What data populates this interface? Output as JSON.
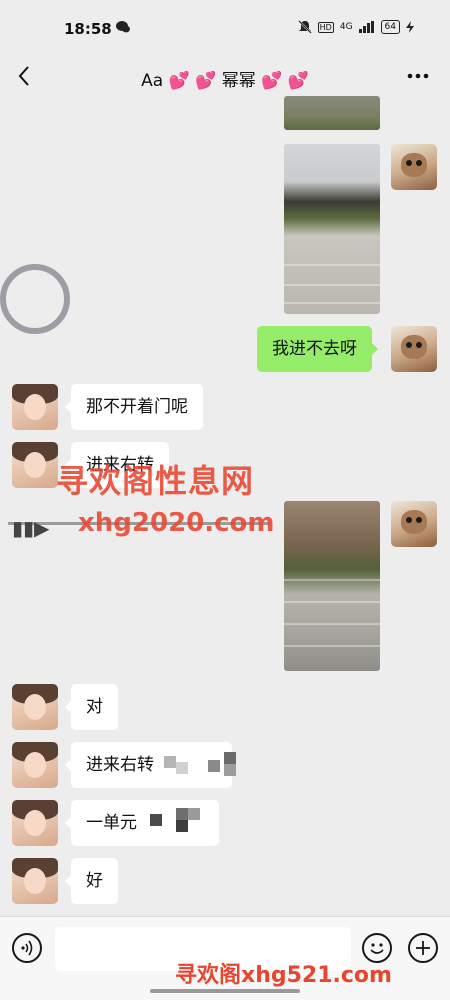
{
  "status_bar": {
    "time": "18:58",
    "network": "4G",
    "hd": "HD",
    "battery": "64",
    "icons": [
      "wechat-msg-icon",
      "mute-icon",
      "hd-icon",
      "signal-icon",
      "battery-icon",
      "charging-icon"
    ]
  },
  "header": {
    "title": "Aa 💕 💕 幂幂 💕 💕",
    "back_icon": "chevron-left-icon",
    "more_icon": "more-icon"
  },
  "messages": [
    {
      "from": "me",
      "type": "image",
      "desc": "building exterior paved plaza"
    },
    {
      "from": "me",
      "type": "text",
      "text": "我进不去呀"
    },
    {
      "from": "other",
      "type": "text",
      "text": "那不开着门呢"
    },
    {
      "from": "other",
      "type": "text",
      "text": "进来右转"
    },
    {
      "from": "me",
      "type": "image",
      "desc": "entrance steps"
    },
    {
      "from": "other",
      "type": "text",
      "text": "对"
    },
    {
      "from": "other",
      "type": "text",
      "text": "进来右转"
    },
    {
      "from": "other",
      "type": "text",
      "text": "一单元"
    },
    {
      "from": "other",
      "type": "text",
      "text": "好"
    }
  ],
  "watermarks": {
    "line1": "寻欢阁性息网",
    "line2": "xhg2020.com",
    "bottom": "寻欢阁xhg521.com"
  },
  "input_bar": {
    "placeholder": "",
    "icons": [
      "voice-icon",
      "emoji-icon",
      "plus-icon"
    ]
  },
  "colors": {
    "background": "#ededed",
    "bubble_in": "#ffffff",
    "bubble_out": "#95ec69",
    "watermark": "#e8452f"
  }
}
